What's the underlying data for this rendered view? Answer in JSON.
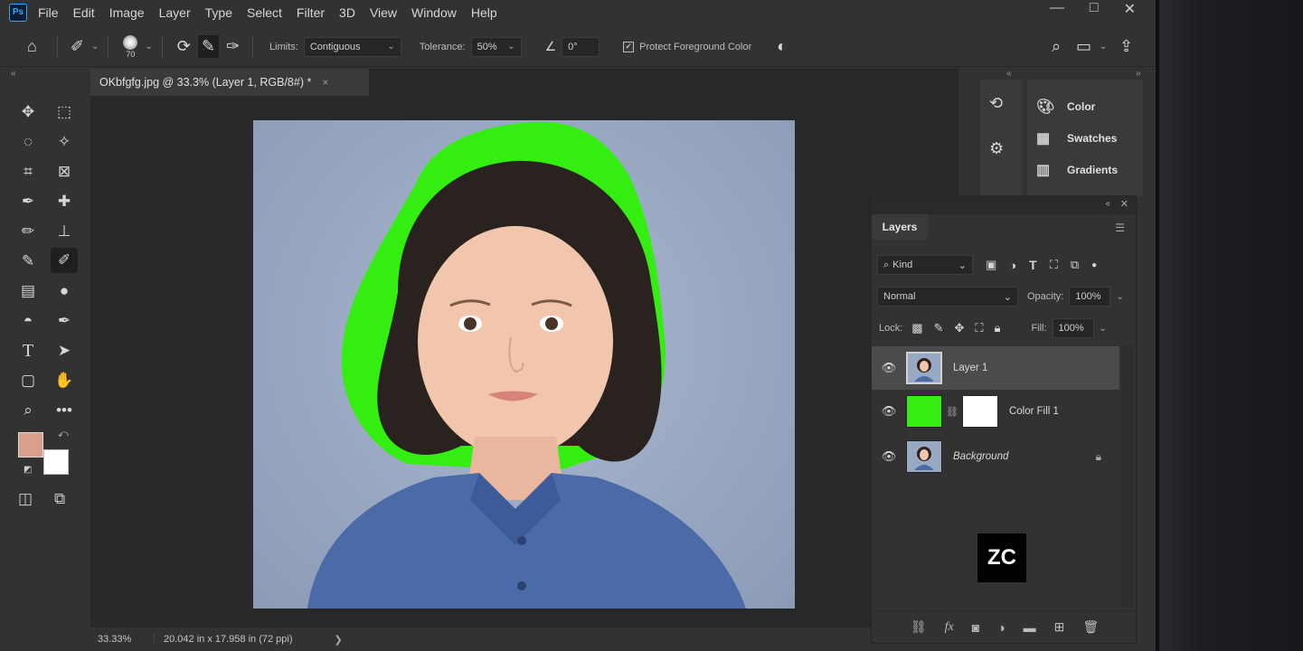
{
  "menubar": {
    "logo": "Ps",
    "items": [
      "File",
      "Edit",
      "Image",
      "Layer",
      "Type",
      "Select",
      "Filter",
      "3D",
      "View",
      "Window",
      "Help"
    ],
    "window_controls": [
      "—",
      "□",
      "✕"
    ]
  },
  "options": {
    "brush_size": "70",
    "limits_label": "Limits:",
    "limits_value": "Contiguous",
    "tolerance_label": "Tolerance:",
    "tolerance_value": "50%",
    "angle_value": "0°",
    "protect_label": "Protect Foreground Color",
    "protect_checked": true
  },
  "document": {
    "tab_title": "OKbfgfg.jpg @ 33.3% (Layer 1, RGB/8#) *",
    "close": "×"
  },
  "status": {
    "zoom": "33.33%",
    "doc_size": "20.042 in x 17.958 in (72 ppi)",
    "arrow": "❯"
  },
  "side_panels": {
    "items": [
      {
        "label": "Color",
        "icon": "palette-icon"
      },
      {
        "label": "Swatches",
        "icon": "swatches-grid-icon"
      },
      {
        "label": "Gradients",
        "icon": "gradient-icon"
      }
    ]
  },
  "layers": {
    "tab": "Layers",
    "filter_kind": "Kind",
    "blend_mode": "Normal",
    "opacity_label": "Opacity:",
    "opacity_value": "100%",
    "lock_label": "Lock:",
    "fill_label": "Fill:",
    "fill_value": "100%",
    "list": [
      {
        "name": "Layer 1",
        "selected": true
      },
      {
        "name": "Color Fill 1",
        "selected": false
      },
      {
        "name": "Background",
        "selected": false,
        "locked": true
      }
    ]
  },
  "colors": {
    "foreground": "#d8a08a",
    "background": "#ffffff",
    "fill_green": "#33ee10"
  },
  "watermark": "ZC"
}
